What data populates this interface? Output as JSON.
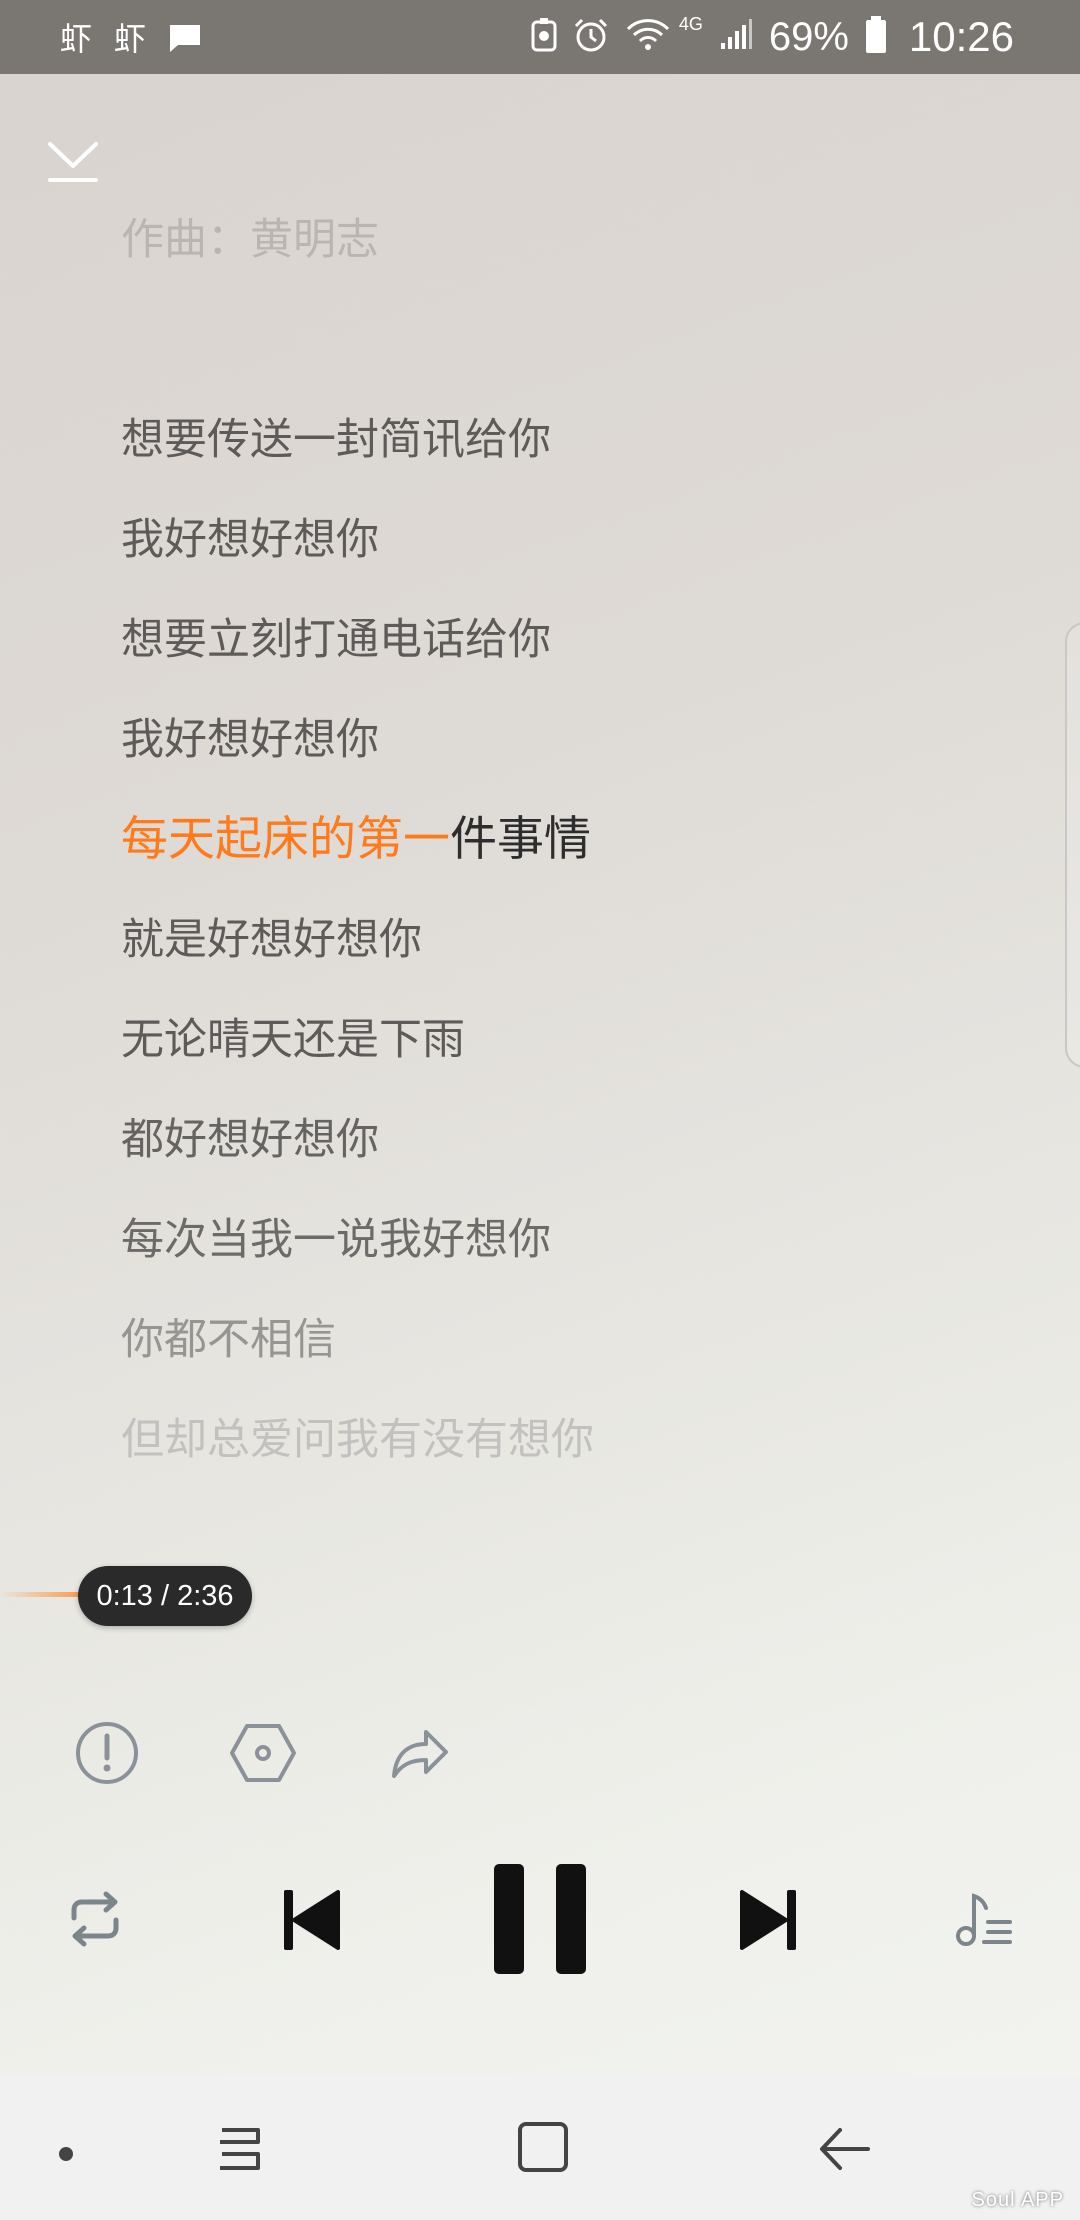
{
  "status_bar": {
    "app_icons": [
      "虾",
      "虾"
    ],
    "network": "4G",
    "battery_percent": "69%",
    "time": "10:26"
  },
  "lyrics": {
    "composer": "作曲：黄明志",
    "lines": [
      "想要传送一封简讯给你",
      "我好想好想你",
      "想要立刻打通电话给你",
      "我好想好想你",
      "就是好想好想你",
      "无论晴天还是下雨",
      "都好想好想你",
      "每次当我一说我好想你",
      "你都不相信",
      "但却总爱问我有没有想你"
    ],
    "active": {
      "sung": "每天起床的第一",
      "remaining": "件事情"
    }
  },
  "playback": {
    "time_display": "0:13 / 2:36",
    "progress_fraction": 0.083
  },
  "actions": {
    "report_icon": "exclamation-circle-icon",
    "effects_icon": "hexagon-settings-icon",
    "share_icon": "share-arrow-icon"
  },
  "controls": {
    "repeat_icon": "repeat-icon",
    "prev_icon": "skip-previous-icon",
    "pause_icon": "pause-icon",
    "next_icon": "skip-next-icon",
    "playlist_icon": "playlist-music-icon"
  },
  "watermark": "Soul APP",
  "colors": {
    "accent": "#ff7a1a",
    "status_bar": "#7a7773"
  }
}
